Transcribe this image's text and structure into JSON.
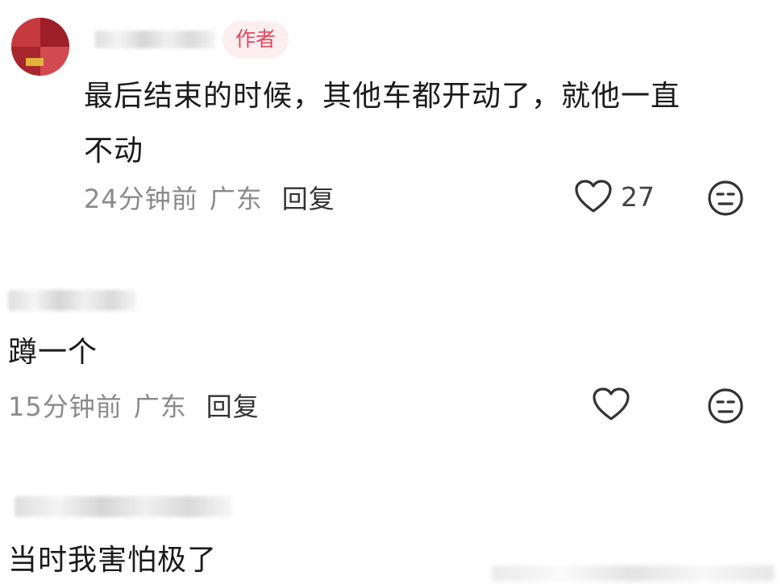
{
  "comments": [
    {
      "badge": "作者",
      "text_line1": "最后结束的时候，其他车都开动了，就他一直",
      "text_line2": "不动",
      "time": "24分钟前",
      "location": "广东",
      "reply_label": "回复",
      "like_count": "27"
    },
    {
      "text": "蹲一个",
      "time": "15分钟前",
      "location": "广东",
      "reply_label": "回复"
    },
    {
      "text": "当时我害怕极了"
    }
  ],
  "icons": {
    "like": "heart-outline-icon",
    "emoji": "neutral-face-icon"
  },
  "colors": {
    "badge_text": "#e5475c",
    "badge_bg": "#fdeef0",
    "meta_text": "#8a8a8a"
  }
}
